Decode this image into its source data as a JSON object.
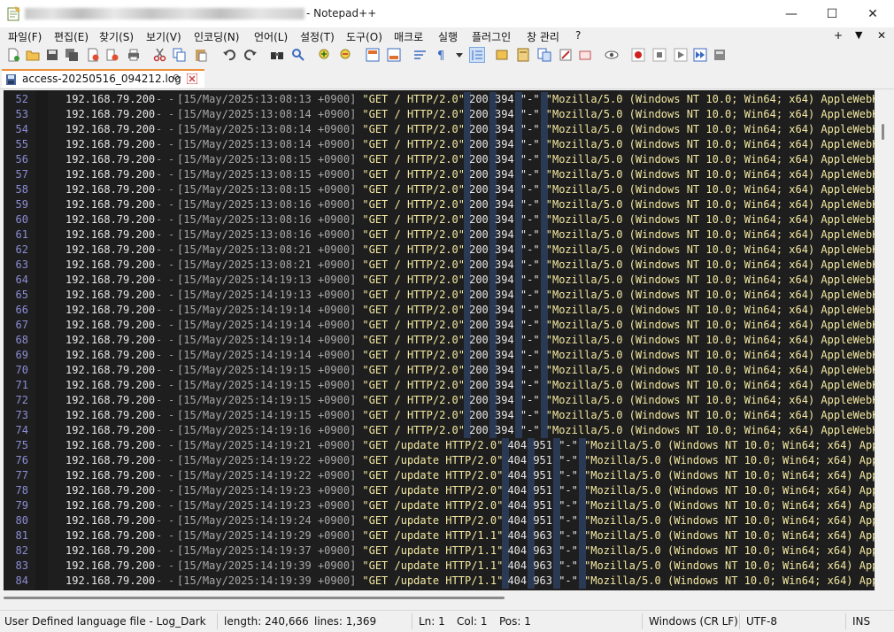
{
  "window": {
    "title_suffix": "- Notepad++",
    "controls": {
      "minimize": "—",
      "maximize": "☐",
      "close": "✕"
    }
  },
  "menu": {
    "items": [
      "파일(F)",
      "편집(E)",
      "찾기(S)",
      "보기(V)",
      "인코딩(N)",
      "언어(L)",
      "설정(T)",
      "도구(O)",
      "매크로",
      "실행",
      "플러그인",
      "창 관리",
      "?"
    ],
    "right": [
      "+",
      "▼",
      "✕"
    ]
  },
  "toolbar": {
    "icons": [
      "new-file-icon",
      "open-file-icon",
      "save-icon",
      "save-all-icon",
      "close-icon",
      "close-all-icon",
      "print-icon",
      "cut-icon",
      "copy-icon",
      "paste-icon",
      "undo-icon",
      "redo-icon",
      "find-icon",
      "replace-icon",
      "zoom-in-icon",
      "zoom-out-icon",
      "sync-vertical-icon",
      "sync-horizontal-icon",
      "word-wrap-icon",
      "show-all-chars-icon",
      "indent-guide-icon",
      "user-lang-icon",
      "doc-map-icon",
      "function-list-icon",
      "folder-workspace-icon",
      "monitor-icon",
      "record-macro-icon",
      "stop-record-icon",
      "play-macro-icon",
      "run-macro-multiple-icon",
      "save-macro-icon"
    ]
  },
  "tab": {
    "label": "access-20250516_094212.log",
    "pin": "📌"
  },
  "log": {
    "ip": "192.168.79.200",
    "dash": "-",
    "referer": "\"-\"",
    "rows": [
      {
        "n": "52",
        "ts": "[15/May/2025:13:08:13 +0900]",
        "req": "\"GET / HTTP/2.0\"",
        "status": "200",
        "size": "394",
        "ua": "\"Mozilla/5.0 (Windows NT 10.0; Win64; x64) AppleWebKit/537.36"
      },
      {
        "n": "53",
        "ts": "[15/May/2025:13:08:14 +0900]",
        "req": "\"GET / HTTP/2.0\"",
        "status": "200",
        "size": "394",
        "ua": "\"Mozilla/5.0 (Windows NT 10.0; Win64; x64) AppleWebKit/537.36"
      },
      {
        "n": "54",
        "ts": "[15/May/2025:13:08:14 +0900]",
        "req": "\"GET / HTTP/2.0\"",
        "status": "200",
        "size": "394",
        "ua": "\"Mozilla/5.0 (Windows NT 10.0; Win64; x64) AppleWebKit/537.36"
      },
      {
        "n": "55",
        "ts": "[15/May/2025:13:08:14 +0900]",
        "req": "\"GET / HTTP/2.0\"",
        "status": "200",
        "size": "394",
        "ua": "\"Mozilla/5.0 (Windows NT 10.0; Win64; x64) AppleWebKit/537.36"
      },
      {
        "n": "56",
        "ts": "[15/May/2025:13:08:15 +0900]",
        "req": "\"GET / HTTP/2.0\"",
        "status": "200",
        "size": "394",
        "ua": "\"Mozilla/5.0 (Windows NT 10.0; Win64; x64) AppleWebKit/537.36"
      },
      {
        "n": "57",
        "ts": "[15/May/2025:13:08:15 +0900]",
        "req": "\"GET / HTTP/2.0\"",
        "status": "200",
        "size": "394",
        "ua": "\"Mozilla/5.0 (Windows NT 10.0; Win64; x64) AppleWebKit/537.36"
      },
      {
        "n": "58",
        "ts": "[15/May/2025:13:08:15 +0900]",
        "req": "\"GET / HTTP/2.0\"",
        "status": "200",
        "size": "394",
        "ua": "\"Mozilla/5.0 (Windows NT 10.0; Win64; x64) AppleWebKit/537.36"
      },
      {
        "n": "59",
        "ts": "[15/May/2025:13:08:16 +0900]",
        "req": "\"GET / HTTP/2.0\"",
        "status": "200",
        "size": "394",
        "ua": "\"Mozilla/5.0 (Windows NT 10.0; Win64; x64) AppleWebKit/537.36"
      },
      {
        "n": "60",
        "ts": "[15/May/2025:13:08:16 +0900]",
        "req": "\"GET / HTTP/2.0\"",
        "status": "200",
        "size": "394",
        "ua": "\"Mozilla/5.0 (Windows NT 10.0; Win64; x64) AppleWebKit/537.36"
      },
      {
        "n": "61",
        "ts": "[15/May/2025:13:08:16 +0900]",
        "req": "\"GET / HTTP/2.0\"",
        "status": "200",
        "size": "394",
        "ua": "\"Mozilla/5.0 (Windows NT 10.0; Win64; x64) AppleWebKit/537.36"
      },
      {
        "n": "62",
        "ts": "[15/May/2025:13:08:21 +0900]",
        "req": "\"GET / HTTP/2.0\"",
        "status": "200",
        "size": "394",
        "ua": "\"Mozilla/5.0 (Windows NT 10.0; Win64; x64) AppleWebKit/537.36"
      },
      {
        "n": "63",
        "ts": "[15/May/2025:13:08:21 +0900]",
        "req": "\"GET / HTTP/2.0\"",
        "status": "200",
        "size": "394",
        "ua": "\"Mozilla/5.0 (Windows NT 10.0; Win64; x64) AppleWebKit/537.36"
      },
      {
        "n": "64",
        "ts": "[15/May/2025:14:19:13 +0900]",
        "req": "\"GET / HTTP/2.0\"",
        "status": "200",
        "size": "394",
        "ua": "\"Mozilla/5.0 (Windows NT 10.0; Win64; x64) AppleWebKit/537.36"
      },
      {
        "n": "65",
        "ts": "[15/May/2025:14:19:13 +0900]",
        "req": "\"GET / HTTP/2.0\"",
        "status": "200",
        "size": "394",
        "ua": "\"Mozilla/5.0 (Windows NT 10.0; Win64; x64) AppleWebKit/537.36"
      },
      {
        "n": "66",
        "ts": "[15/May/2025:14:19:14 +0900]",
        "req": "\"GET / HTTP/2.0\"",
        "status": "200",
        "size": "394",
        "ua": "\"Mozilla/5.0 (Windows NT 10.0; Win64; x64) AppleWebKit/537.36"
      },
      {
        "n": "67",
        "ts": "[15/May/2025:14:19:14 +0900]",
        "req": "\"GET / HTTP/2.0\"",
        "status": "200",
        "size": "394",
        "ua": "\"Mozilla/5.0 (Windows NT 10.0; Win64; x64) AppleWebKit/537.36"
      },
      {
        "n": "68",
        "ts": "[15/May/2025:14:19:14 +0900]",
        "req": "\"GET / HTTP/2.0\"",
        "status": "200",
        "size": "394",
        "ua": "\"Mozilla/5.0 (Windows NT 10.0; Win64; x64) AppleWebKit/537.36"
      },
      {
        "n": "69",
        "ts": "[15/May/2025:14:19:14 +0900]",
        "req": "\"GET / HTTP/2.0\"",
        "status": "200",
        "size": "394",
        "ua": "\"Mozilla/5.0 (Windows NT 10.0; Win64; x64) AppleWebKit/537.36"
      },
      {
        "n": "70",
        "ts": "[15/May/2025:14:19:15 +0900]",
        "req": "\"GET / HTTP/2.0\"",
        "status": "200",
        "size": "394",
        "ua": "\"Mozilla/5.0 (Windows NT 10.0; Win64; x64) AppleWebKit/537.36"
      },
      {
        "n": "71",
        "ts": "[15/May/2025:14:19:15 +0900]",
        "req": "\"GET / HTTP/2.0\"",
        "status": "200",
        "size": "394",
        "ua": "\"Mozilla/5.0 (Windows NT 10.0; Win64; x64) AppleWebKit/537.36"
      },
      {
        "n": "72",
        "ts": "[15/May/2025:14:19:15 +0900]",
        "req": "\"GET / HTTP/2.0\"",
        "status": "200",
        "size": "394",
        "ua": "\"Mozilla/5.0 (Windows NT 10.0; Win64; x64) AppleWebKit/537.36"
      },
      {
        "n": "73",
        "ts": "[15/May/2025:14:19:15 +0900]",
        "req": "\"GET / HTTP/2.0\"",
        "status": "200",
        "size": "394",
        "ua": "\"Mozilla/5.0 (Windows NT 10.0; Win64; x64) AppleWebKit/537.36"
      },
      {
        "n": "74",
        "ts": "[15/May/2025:14:19:16 +0900]",
        "req": "\"GET / HTTP/2.0\"",
        "status": "200",
        "size": "394",
        "ua": "\"Mozilla/5.0 (Windows NT 10.0; Win64; x64) AppleWebKit/537.36"
      },
      {
        "n": "75",
        "ts": "[15/May/2025:14:19:21 +0900]",
        "req": "\"GET /update HTTP/2.0\"",
        "status": "404",
        "size": "951",
        "ua": "\"Mozilla/5.0 (Windows NT 10.0; Win64; x64) AppleWebKit/"
      },
      {
        "n": "76",
        "ts": "[15/May/2025:14:19:22 +0900]",
        "req": "\"GET /update HTTP/2.0\"",
        "status": "404",
        "size": "951",
        "ua": "\"Mozilla/5.0 (Windows NT 10.0; Win64; x64) AppleWebKit/"
      },
      {
        "n": "77",
        "ts": "[15/May/2025:14:19:22 +0900]",
        "req": "\"GET /update HTTP/2.0\"",
        "status": "404",
        "size": "951",
        "ua": "\"Mozilla/5.0 (Windows NT 10.0; Win64; x64) AppleWebKit/"
      },
      {
        "n": "78",
        "ts": "[15/May/2025:14:19:23 +0900]",
        "req": "\"GET /update HTTP/2.0\"",
        "status": "404",
        "size": "951",
        "ua": "\"Mozilla/5.0 (Windows NT 10.0; Win64; x64) AppleWebKit/"
      },
      {
        "n": "79",
        "ts": "[15/May/2025:14:19:23 +0900]",
        "req": "\"GET /update HTTP/2.0\"",
        "status": "404",
        "size": "951",
        "ua": "\"Mozilla/5.0 (Windows NT 10.0; Win64; x64) AppleWebKit/"
      },
      {
        "n": "80",
        "ts": "[15/May/2025:14:19:24 +0900]",
        "req": "\"GET /update HTTP/2.0\"",
        "status": "404",
        "size": "951",
        "ua": "\"Mozilla/5.0 (Windows NT 10.0; Win64; x64) AppleWebKit/"
      },
      {
        "n": "81",
        "ts": "[15/May/2025:14:19:29 +0900]",
        "req": "\"GET /update HTTP/1.1\"",
        "status": "404",
        "size": "963",
        "ua": "\"Mozilla/5.0 (Windows NT 10.0; Win64; x64) AppleWebKit/"
      },
      {
        "n": "82",
        "ts": "[15/May/2025:14:19:37 +0900]",
        "req": "\"GET /update HTTP/1.1\"",
        "status": "404",
        "size": "963",
        "ua": "\"Mozilla/5.0 (Windows NT 10.0; Win64; x64) AppleWebKit/"
      },
      {
        "n": "83",
        "ts": "[15/May/2025:14:19:39 +0900]",
        "req": "\"GET /update HTTP/1.1\"",
        "status": "404",
        "size": "963",
        "ua": "\"Mozilla/5.0 (Windows NT 10.0; Win64; x64) AppleWebKit/"
      },
      {
        "n": "84",
        "ts": "[15/May/2025:14:19:39 +0900]",
        "req": "\"GET /update HTTP/1.1\"",
        "status": "404",
        "size": "963",
        "ua": "\"Mozilla/5.0 (Windows NT 10.0; Win64; x64) AppleWebKit/"
      }
    ]
  },
  "status": {
    "lang": "User Defined language file - Log_Dark",
    "length": "length: 240,666",
    "lines": "lines: 1,369",
    "ln": "Ln: 1",
    "col": "Col: 1",
    "pos": "Pos: 1",
    "eol": "Windows (CR LF)",
    "encoding": "UTF-8",
    "mode": "INS"
  },
  "colors": {
    "editor_bg": "#1e1e1e",
    "line_number": "#8b8dd6",
    "request": "#f4e9a2",
    "tab_accent": "#ef8f3a"
  }
}
